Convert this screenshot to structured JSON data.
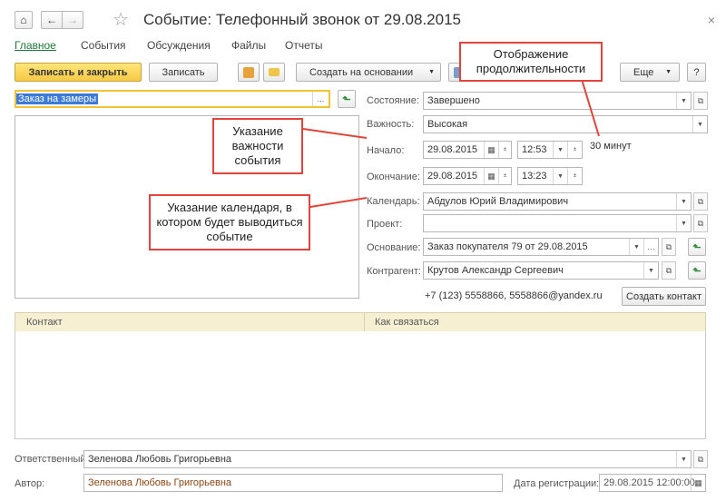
{
  "window": {
    "title": "Событие: Телефонный звонок от 29.08.2015",
    "home_icon": "⌂",
    "back_icon": "←",
    "forward_icon": "→",
    "star_icon": "☆",
    "close_icon": "×"
  },
  "tabs": [
    {
      "label": "Главное"
    },
    {
      "label": "События"
    },
    {
      "label": "Обсуждения"
    },
    {
      "label": "Файлы"
    },
    {
      "label": "Отчеты"
    }
  ],
  "toolbar": {
    "save_close_label": "Записать и закрыть",
    "save_label": "Записать",
    "create_based_label": "Создать на основании",
    "more_label": "Еще",
    "help_label": "?"
  },
  "subject": {
    "value": "Заказ на замеры",
    "ellipsis": "..."
  },
  "form": {
    "state_label": "Состояние:",
    "state_value": "Завершено",
    "importance_label": "Важность:",
    "importance_value": "Высокая",
    "start_label": "Начало:",
    "start_date": "29.08.2015",
    "start_time": "12:53",
    "duration": "30 минут",
    "end_label": "Окончание:",
    "end_date": "29.08.2015",
    "end_time": "13:23",
    "calendar_label": "Календарь:",
    "calendar_value": "Абдулов Юрий Владимирович",
    "project_label": "Проект:",
    "project_value": "",
    "basis_label": "Основание:",
    "basis_value": "Заказ покупателя 79 от 29.08.2015",
    "contractor_label": "Контрагент:",
    "contractor_value": "Крутов Александр Сергеевич",
    "contact_info": "+7 (123) 5558866, 5558866@yandex.ru",
    "create_contact_label": "Создать контакт"
  },
  "table": {
    "columns": [
      "Контакт",
      "Как связаться"
    ]
  },
  "footer": {
    "responsible_label": "Ответственный:",
    "responsible_value": "Зеленова Любовь Григорьевна",
    "author_label": "Автор:",
    "author_value": "Зеленова Любовь Григорьевна",
    "reg_date_label": "Дата регистрации:",
    "reg_date_value": "29.08.2015 12:00:00"
  },
  "callouts": {
    "duration": "Отображение продолжительности",
    "importance": "Указание важности события",
    "calendar": "Указание календаря, в котором будет выводиться событие"
  },
  "colors": {
    "accent_yellow": "#f7c945",
    "link_green": "#1b7a3b",
    "callout_red": "#e2433a",
    "author_brown": "#8b4513"
  }
}
